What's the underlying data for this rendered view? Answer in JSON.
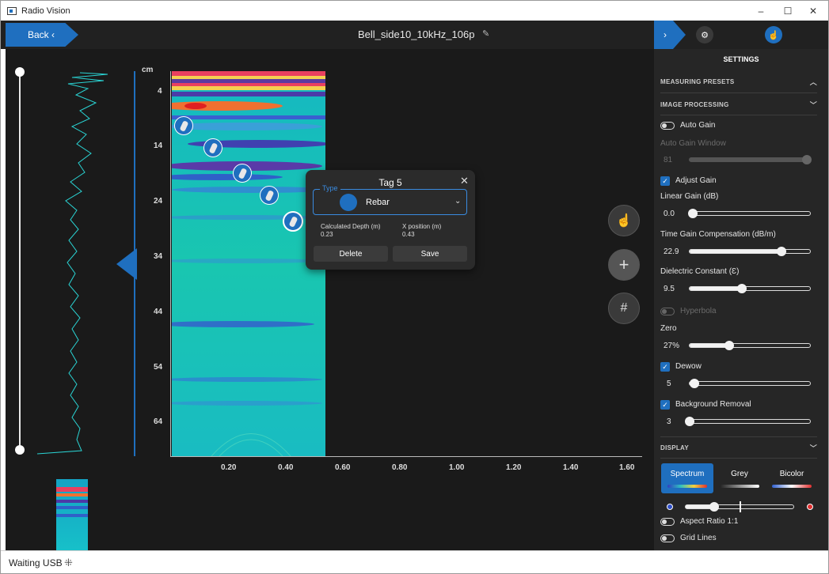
{
  "window": {
    "title": "Radio Vision",
    "minimize": "–",
    "maximize": "☐",
    "close": "✕"
  },
  "header": {
    "back_label": "Back ‹",
    "file_title": "Bell_side10_10kHz_106p",
    "edit_icon": "pencil-icon"
  },
  "scan": {
    "y_unit": "cm",
    "y_ticks": [
      "4",
      "14",
      "24",
      "34",
      "44",
      "54",
      "64"
    ],
    "x_ticks": [
      "0.20",
      "0.40",
      "0.60",
      "0.80",
      "1.00",
      "1.20",
      "1.40",
      "1.60"
    ],
    "colors": {
      "accent": "#1f6fbf",
      "trace": "#2ad4d4"
    }
  },
  "tag_popup": {
    "title": "Tag 5",
    "type_legend": "Type",
    "type_value": "Rebar",
    "depth_label": "Calculated Depth (m)",
    "depth_value": "0.23",
    "xpos_label": "X position (m)",
    "xpos_value": "0.43",
    "delete_label": "Delete",
    "save_label": "Save"
  },
  "status": {
    "text": "Waiting USB",
    "spinner": "⁜"
  },
  "settings": {
    "heading": "SETTINGS",
    "measuring_presets": "MEASURING PRESETS",
    "image_processing": "IMAGE PROCESSING",
    "display": "DISPLAY",
    "auto_gain": {
      "label": "Auto Gain",
      "on": false
    },
    "auto_gain_window": {
      "label": "Auto Gain Window",
      "value": "81",
      "level": 1.0
    },
    "adjust_gain": {
      "label": "Adjust Gain",
      "checked": true
    },
    "linear_gain": {
      "label": "Linear Gain (dB)",
      "value": "0.0",
      "level": 0.0
    },
    "tgc": {
      "label": "Time Gain Compensation (dB/m)",
      "value": "22.9",
      "level": 0.76
    },
    "dielectric": {
      "label": "Dielectric Constant (Ɛ)",
      "value": "9.5",
      "level": 0.43
    },
    "hyperbola": {
      "label": "Hyperbola",
      "on": false
    },
    "zero": {
      "label": "Zero",
      "value": "27%",
      "level": 0.33
    },
    "dewow": {
      "label": "Dewow",
      "checked": true,
      "value": "5",
      "level": 0.02
    },
    "background_removal": {
      "label": "Background Removal",
      "checked": true,
      "value": "3",
      "level": 0.0
    },
    "color_tabs": [
      "Spectrum",
      "Grey",
      "Bicolor"
    ],
    "aspect_ratio": {
      "label": "Aspect Ratio 1:1",
      "on": false
    },
    "grid_lines": {
      "label": "Grid Lines",
      "on": false
    }
  }
}
